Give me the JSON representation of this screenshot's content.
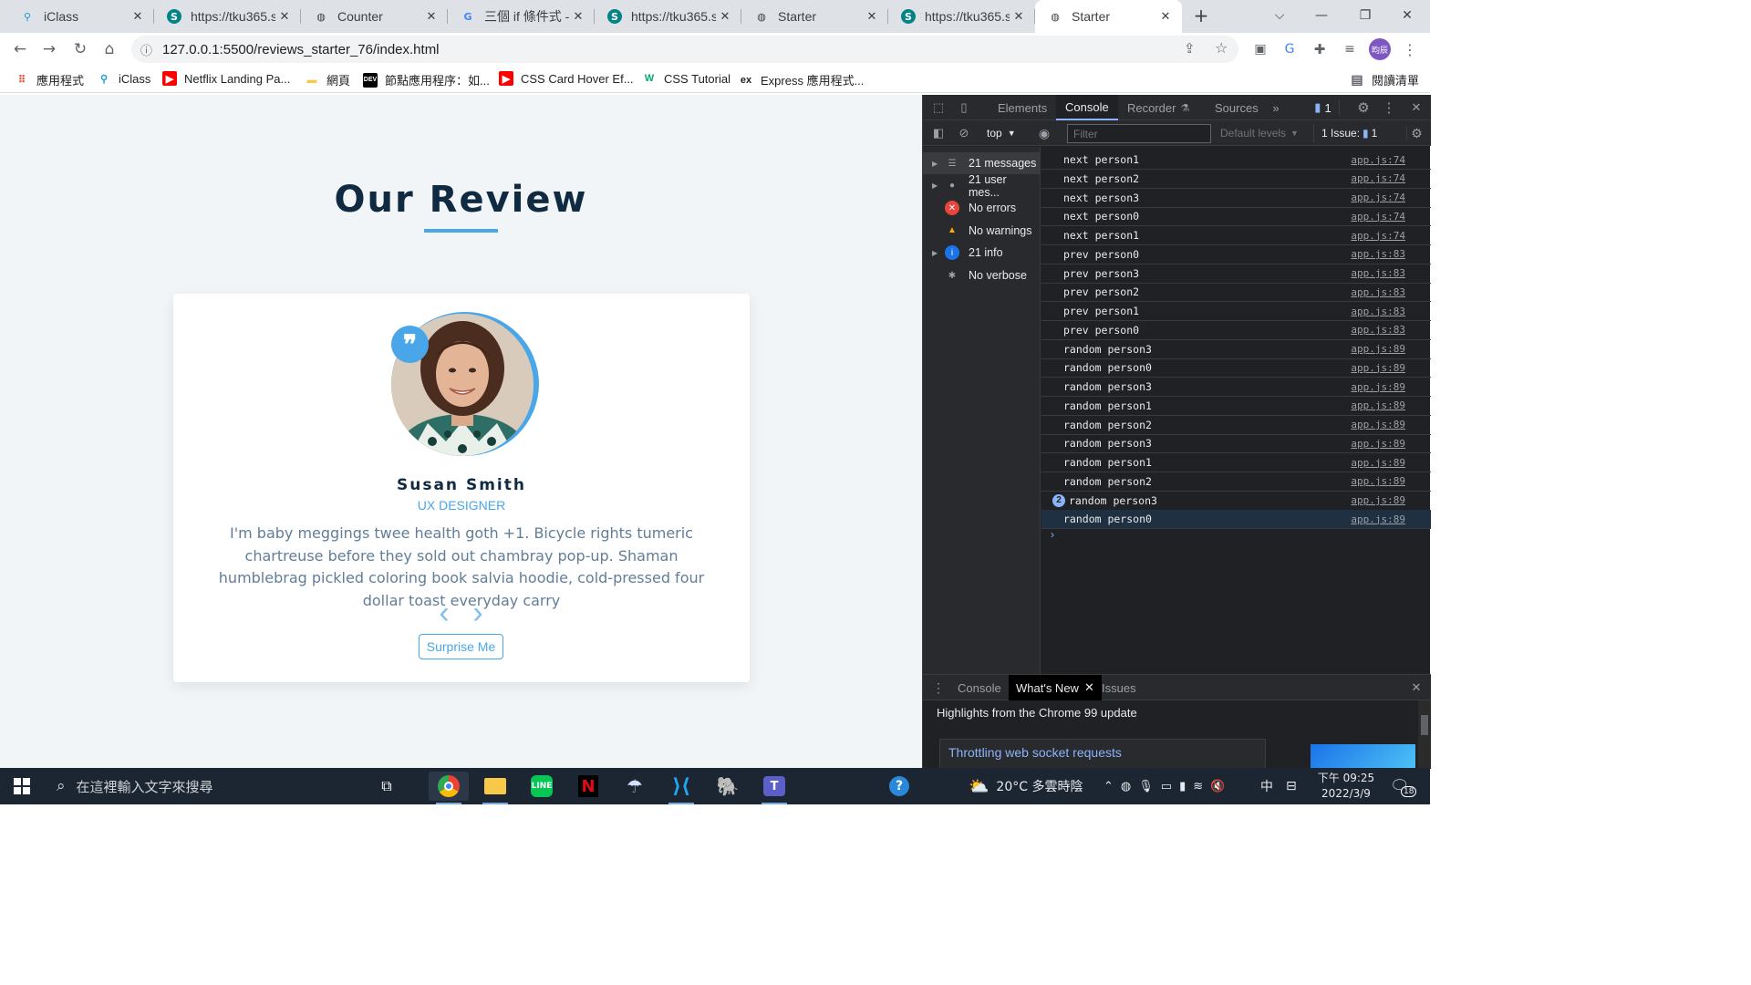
{
  "browser": {
    "tabs": [
      {
        "title": "iClass",
        "icon": "iclass-icon"
      },
      {
        "title": "https://tku365.sh",
        "icon": "sharepoint-icon"
      },
      {
        "title": "Counter",
        "icon": "globe-icon"
      },
      {
        "title": "三個 if 條件式 - G",
        "icon": "google-icon"
      },
      {
        "title": "https://tku365.sh",
        "icon": "sharepoint-icon"
      },
      {
        "title": "Starter",
        "icon": "globe-icon"
      },
      {
        "title": "https://tku365.sh",
        "icon": "sharepoint-icon"
      },
      {
        "title": "Starter",
        "icon": "globe-icon",
        "active": true
      }
    ],
    "url": "127.0.0.1:5500/reviews_starter_76/index.html",
    "profile_initials": "昀辰",
    "bookmarks": [
      {
        "label": "應用程式",
        "icon": "apps-grid-icon"
      },
      {
        "label": "iClass",
        "icon": "iclass-icon"
      },
      {
        "label": "Netflix Landing Pa...",
        "icon": "youtube-icon"
      },
      {
        "label": "網頁",
        "icon": "folder-icon"
      },
      {
        "label": "節點應用程序：如...",
        "icon": "dev-icon"
      },
      {
        "label": "CSS Card Hover Ef...",
        "icon": "youtube-icon"
      },
      {
        "label": "CSS Tutorial",
        "icon": "w3schools-icon"
      },
      {
        "label": "Express 應用程式...",
        "icon": "express-icon"
      }
    ],
    "reading_list": "閱讀清單"
  },
  "page": {
    "title": "Our Review",
    "review": {
      "author": "Susan Smith",
      "job": "UX DESIGNER",
      "text": "I'm baby meggings twee health goth +1. Bicycle rights tumeric chartreuse before they sold out chambray pop-up. Shaman humblebrag pickled coloring book salvia hoodie, cold-pressed four dollar toast everyday carry",
      "quote_glyph": "❞"
    },
    "prev_glyph": "‹",
    "next_glyph": "›",
    "surprise_button": "Surprise Me"
  },
  "devtools": {
    "tabs": [
      "Elements",
      "Console",
      "Recorder",
      "Sources"
    ],
    "active_tab": "Console",
    "issue_count_badge": "1",
    "context": "top",
    "filter_placeholder": "Filter",
    "levels": "Default levels",
    "issues": "1 Issue:",
    "issues_count": "1",
    "sidebar": [
      {
        "label": "21 messages",
        "icon": "list-icon",
        "expand": true,
        "active": true
      },
      {
        "label": "21 user mes...",
        "icon": "user-icon",
        "expand": true
      },
      {
        "label": "No errors",
        "icon": "error-icon",
        "expand": false
      },
      {
        "label": "No warnings",
        "icon": "warning-icon",
        "expand": false
      },
      {
        "label": "21 info",
        "icon": "info-icon",
        "expand": true
      },
      {
        "label": "No verbose",
        "icon": "bug-icon",
        "expand": false
      }
    ],
    "messages": [
      {
        "text": "next person1",
        "source": "app.js:74"
      },
      {
        "text": "next person2",
        "source": "app.js:74"
      },
      {
        "text": "next person3",
        "source": "app.js:74"
      },
      {
        "text": "next person0",
        "source": "app.js:74"
      },
      {
        "text": "next person1",
        "source": "app.js:74"
      },
      {
        "text": "prev person0",
        "source": "app.js:83"
      },
      {
        "text": "prev person3",
        "source": "app.js:83"
      },
      {
        "text": "prev person2",
        "source": "app.js:83"
      },
      {
        "text": "prev person1",
        "source": "app.js:83"
      },
      {
        "text": "prev person0",
        "source": "app.js:83"
      },
      {
        "text": "random person3",
        "source": "app.js:89"
      },
      {
        "text": "random person0",
        "source": "app.js:89"
      },
      {
        "text": "random person3",
        "source": "app.js:89"
      },
      {
        "text": "random person1",
        "source": "app.js:89"
      },
      {
        "text": "random person2",
        "source": "app.js:89"
      },
      {
        "text": "random person3",
        "source": "app.js:89"
      },
      {
        "text": "random person1",
        "source": "app.js:89"
      },
      {
        "text": "random person2",
        "source": "app.js:89"
      },
      {
        "text": "random person3",
        "source": "app.js:89",
        "count": "2"
      },
      {
        "text": "random person0",
        "source": "app.js:89",
        "selected": true
      }
    ],
    "drawer": {
      "tabs": [
        "Console",
        "What's New",
        "Issues"
      ],
      "active_tab": "What's New",
      "heading": "Highlights from the Chrome 99 update",
      "link": "Throttling web socket requests"
    }
  },
  "taskbar": {
    "search_placeholder": "在這裡輸入文字來搜尋",
    "weather": "20°C 多雲時陰",
    "ime": "中",
    "time": "下午 09:25",
    "date": "2022/3/9",
    "notifications": "18"
  },
  "colors": {
    "accent": "#49a6e9",
    "heading": "#102a42",
    "body_text": "#617d98",
    "page_bg": "#f1f5f8"
  }
}
